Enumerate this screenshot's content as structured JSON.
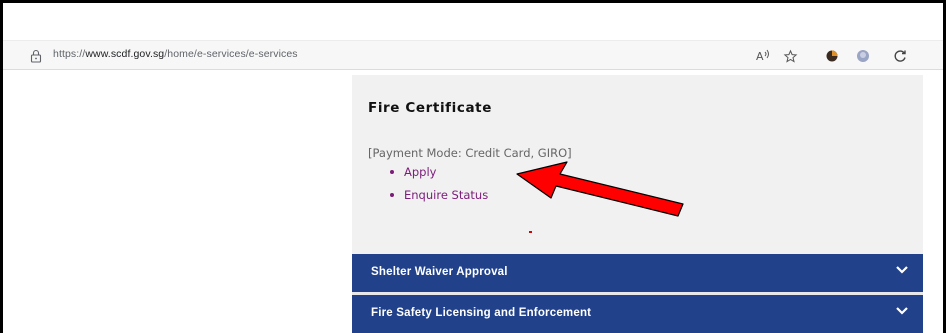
{
  "browser": {
    "url_prefix": "https://",
    "url_host": "www.scdf.gov.sg",
    "url_path": "/home/e-services/e-services",
    "icons": [
      "lock-icon",
      "read-aloud-icon",
      "favorite-star-icon",
      "extension-icon",
      "profile-icon",
      "refresh-icon"
    ]
  },
  "section": {
    "title": "Fire Certificate",
    "payment_mode": "[Payment Mode: Credit Card, GIRO]",
    "links": [
      {
        "label": "Apply"
      },
      {
        "label": "Enquire Status"
      }
    ]
  },
  "accordions": [
    {
      "label": "Shelter Waiver Approval"
    },
    {
      "label": "Fire Safety Licensing and Enforcement"
    }
  ],
  "colors": {
    "link": "#7b1c79",
    "accordion_bg": "#21428a",
    "panel_bg": "#f1f1f1",
    "annotation_arrow": "#ff0000"
  }
}
